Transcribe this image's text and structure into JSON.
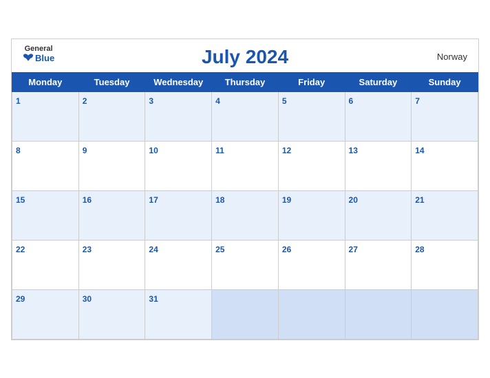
{
  "header": {
    "title": "July 2024",
    "country": "Norway",
    "logo_general": "General",
    "logo_blue": "Blue"
  },
  "weekdays": [
    "Monday",
    "Tuesday",
    "Wednesday",
    "Thursday",
    "Friday",
    "Saturday",
    "Sunday"
  ],
  "weeks": [
    [
      1,
      2,
      3,
      4,
      5,
      6,
      7
    ],
    [
      8,
      9,
      10,
      11,
      12,
      13,
      14
    ],
    [
      15,
      16,
      17,
      18,
      19,
      20,
      21
    ],
    [
      22,
      23,
      24,
      25,
      26,
      27,
      28
    ],
    [
      29,
      30,
      31,
      null,
      null,
      null,
      null
    ]
  ]
}
